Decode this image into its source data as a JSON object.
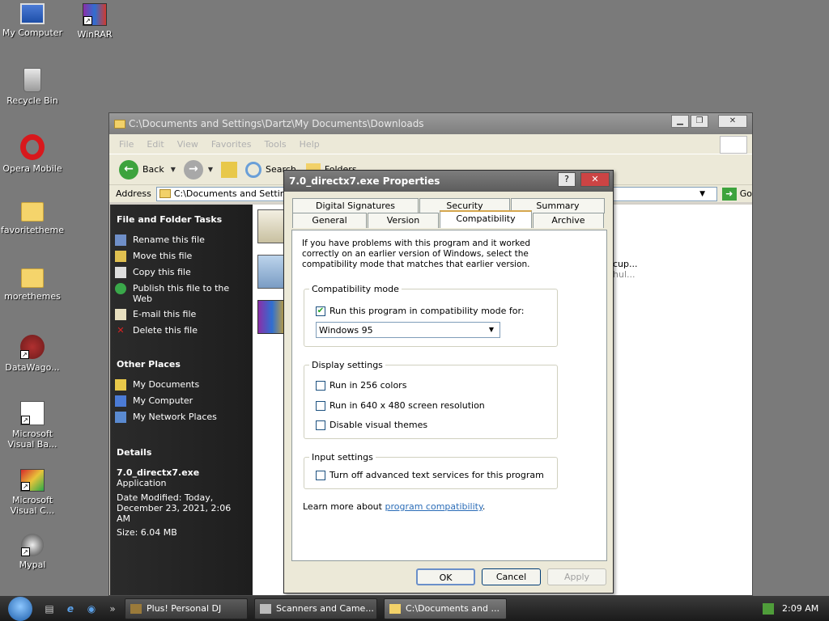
{
  "desktop": {
    "icons": [
      {
        "label": "My Computer"
      },
      {
        "label": "WinRAR"
      },
      {
        "label": "Recycle Bin"
      },
      {
        "label": "Opera Mobile"
      },
      {
        "label": "favoritetheme"
      },
      {
        "label": "morethemes"
      },
      {
        "label": "DataWago..."
      },
      {
        "label": "Microsoft Visual Ba..."
      },
      {
        "label": "Microsoft Visual C..."
      },
      {
        "label": "Mypal"
      }
    ]
  },
  "explorer": {
    "title": "C:\\Documents and Settings\\Dartz\\My Documents\\Downloads",
    "menu": [
      "File",
      "Edit",
      "View",
      "Favorites",
      "Tools",
      "Help"
    ],
    "toolbar": {
      "back": "Back",
      "search": "Search",
      "folders": "Folders"
    },
    "address": {
      "label": "Address",
      "value": "C:\\Documents and Settings",
      "go": "Go"
    },
    "file_tasks": {
      "title": "File and Folder Tasks",
      "items": [
        "Rename this file",
        "Move this file",
        "Copy this file",
        "Publish this file to the Web",
        "E-mail this file",
        "Delete this file"
      ]
    },
    "other_places": {
      "title": "Other Places",
      "items": [
        "My Documents",
        "My Computer",
        "My Network Places"
      ]
    },
    "details": {
      "title": "Details",
      "name": "7.0_directx7.exe",
      "type": "Application",
      "modified": "Date Modified: Today, December 23, 2021, 2:06 AM",
      "size": "Size: 6.04 MB"
    },
    "partial_file": {
      "line1": "cup...",
      "line2": "hul..."
    }
  },
  "dialog": {
    "title": "7.0_directx7.exe Properties",
    "help": "?",
    "close": "✕",
    "tabs_top": [
      "Digital Signatures",
      "Security",
      "Summary"
    ],
    "tabs_bottom": [
      "General",
      "Version",
      "Compatibility",
      "Archive"
    ],
    "intro": "If you have problems with this program and it worked correctly on an earlier version of Windows, select the compatibility mode that matches that earlier version.",
    "compat_mode": {
      "title": "Compatibility mode",
      "checkbox": "Run this program in compatibility mode for:",
      "checked": true,
      "selected": "Windows 95"
    },
    "display": {
      "title": "Display settings",
      "items": [
        "Run in 256 colors",
        "Run in 640 x 480 screen resolution",
        "Disable visual themes"
      ]
    },
    "input": {
      "title": "Input settings",
      "item": "Turn off advanced text services for this program"
    },
    "learn_prefix": "Learn more about ",
    "learn_link": "program compatibility",
    "learn_suffix": ".",
    "buttons": {
      "ok": "OK",
      "cancel": "Cancel",
      "apply": "Apply"
    }
  },
  "taskbar": {
    "tasks": [
      "Plus! Personal DJ",
      "Scanners and Came...",
      "C:\\Documents and ..."
    ],
    "chevron": "»",
    "clock": "2:09 AM"
  }
}
